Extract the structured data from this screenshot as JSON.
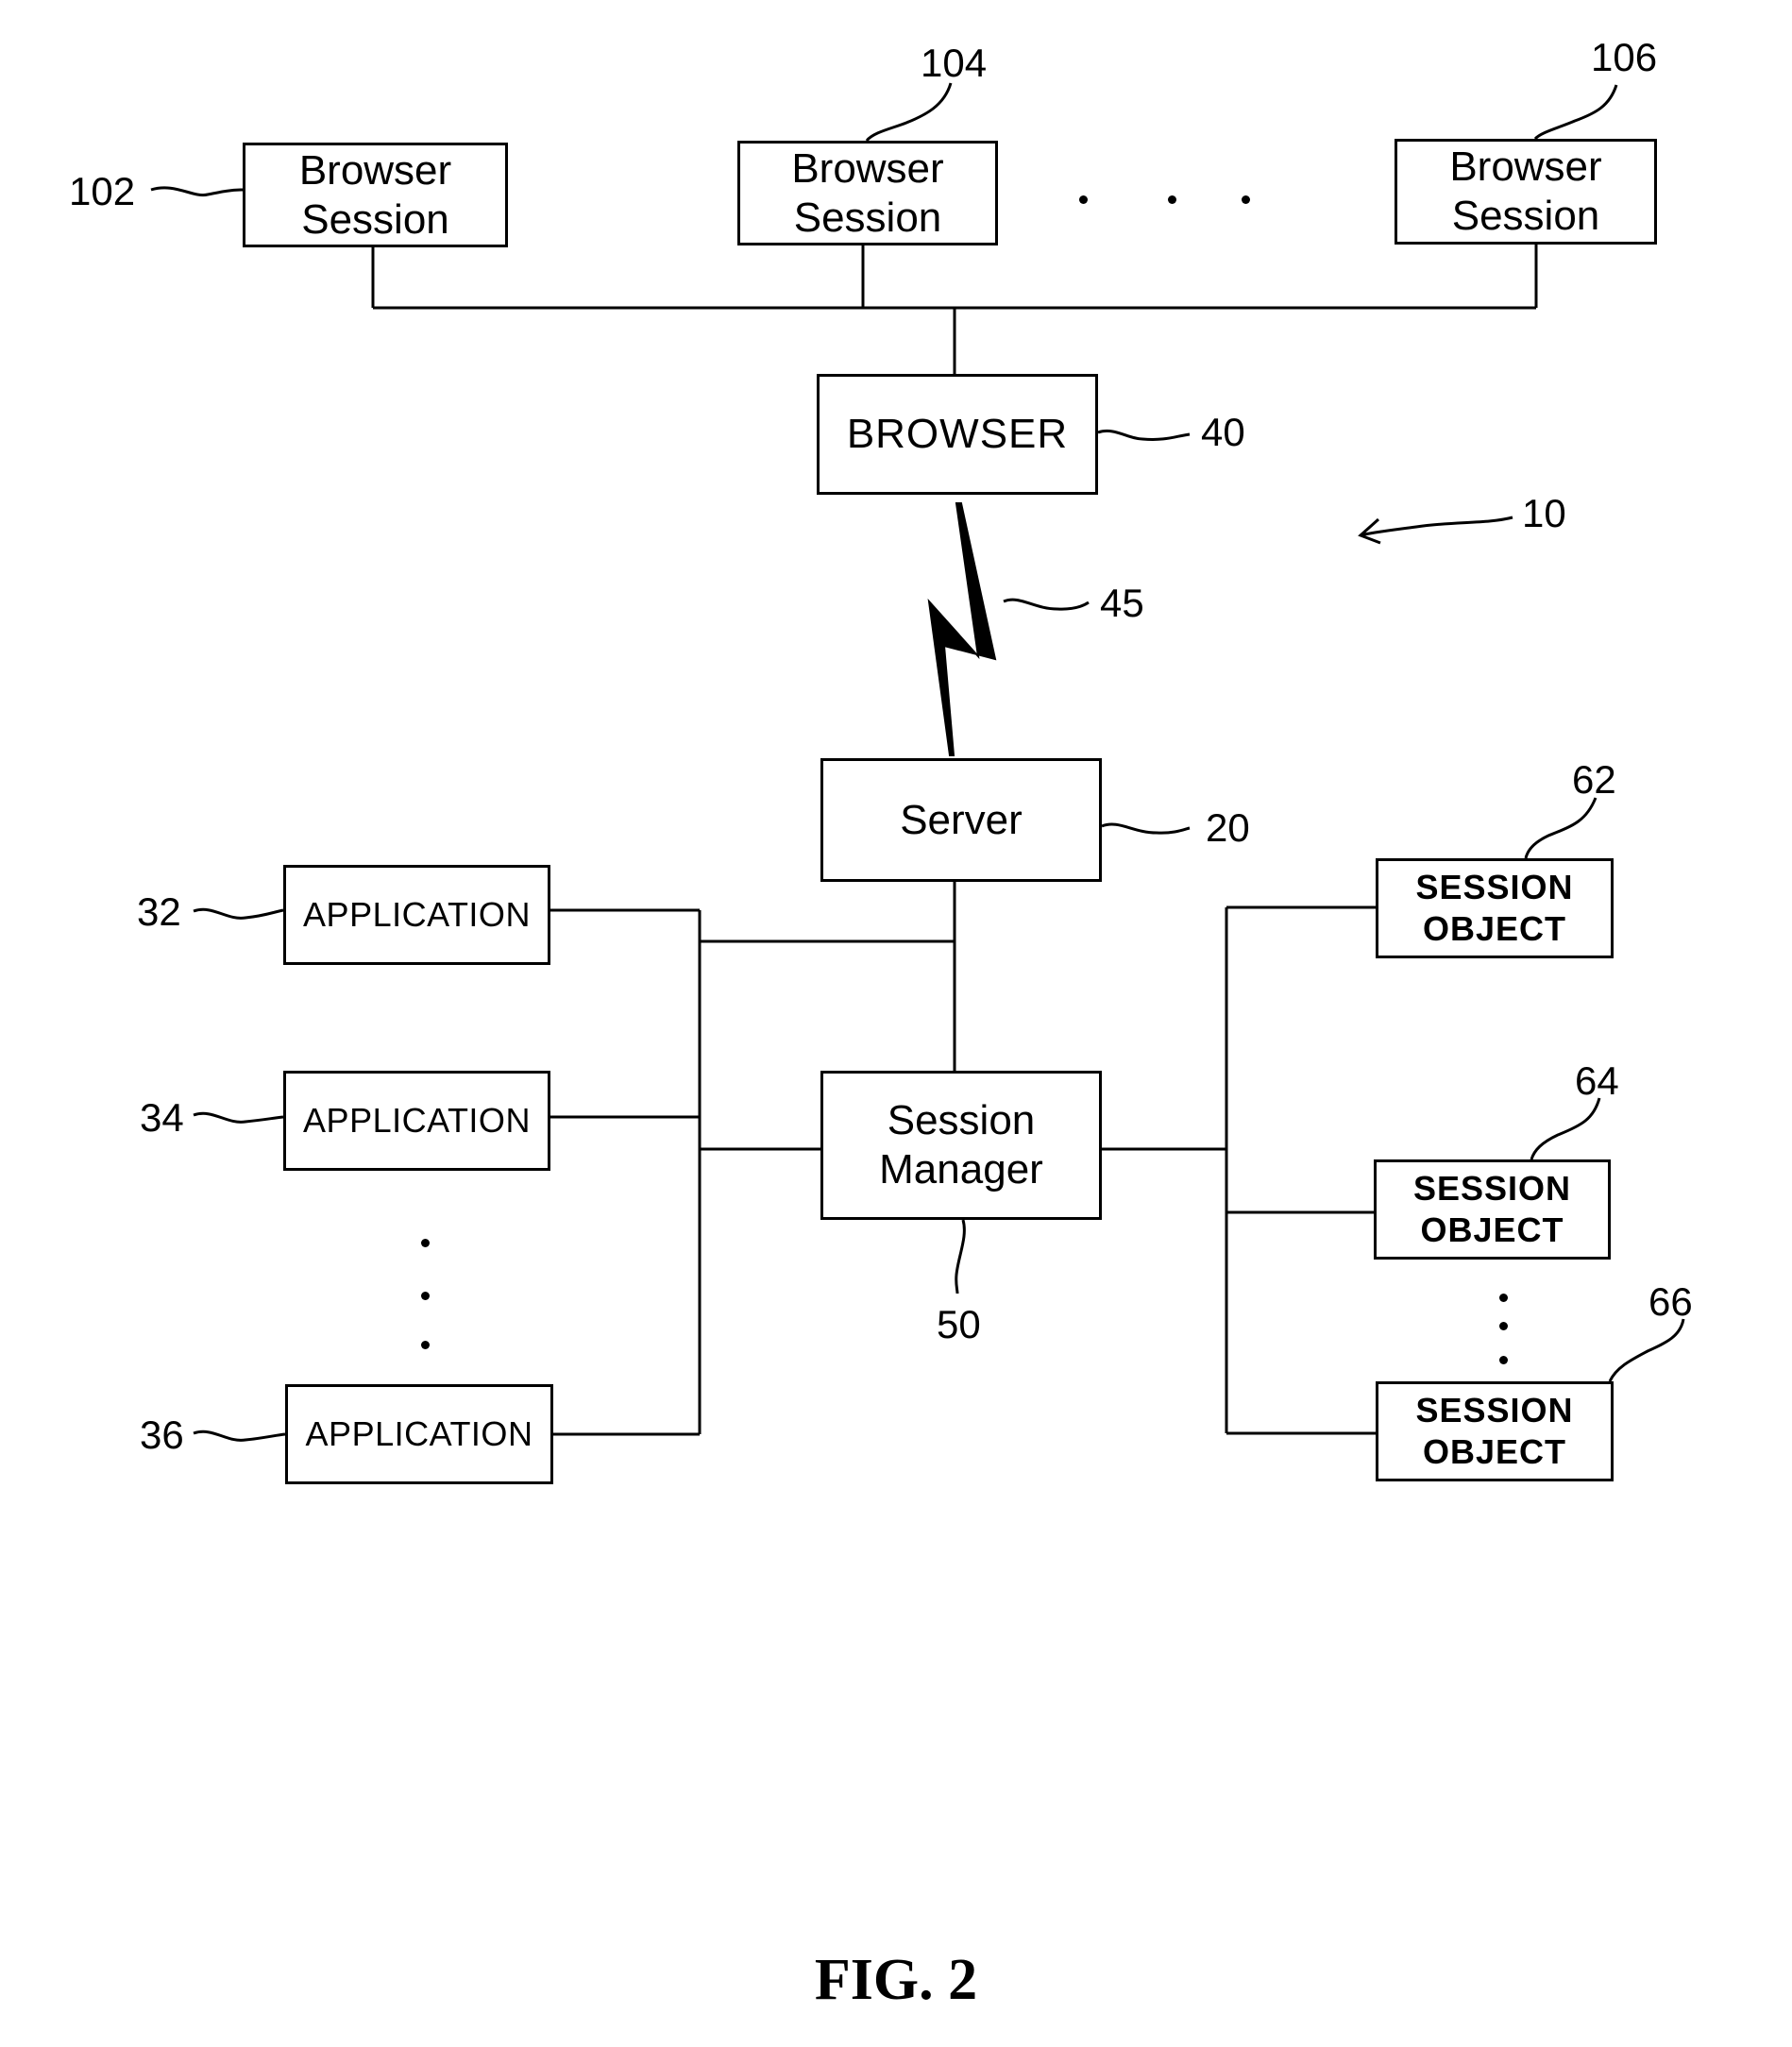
{
  "figure": {
    "caption": "FIG. 2",
    "system_ref": "10"
  },
  "browser_sessions": [
    {
      "ref": "102",
      "line1": "Browser",
      "line2": "Session"
    },
    {
      "ref": "104",
      "line1": "Browser",
      "line2": "Session"
    },
    {
      "ref": "106",
      "line1": "Browser",
      "line2": "Session"
    }
  ],
  "browser": {
    "ref": "40",
    "label": "BROWSER"
  },
  "link": {
    "ref": "45",
    "icon": "lightning-bolt-icon"
  },
  "server": {
    "ref": "20",
    "label": "Server"
  },
  "session_manager": {
    "ref": "50",
    "line1": "Session",
    "line2": "Manager"
  },
  "applications": [
    {
      "ref": "32",
      "label": "APPLICATION"
    },
    {
      "ref": "34",
      "label": "APPLICATION"
    },
    {
      "ref": "36",
      "label": "APPLICATION"
    }
  ],
  "session_objects": [
    {
      "ref": "62",
      "line1": "SESSION",
      "line2": "OBJECT"
    },
    {
      "ref": "64",
      "line1": "SESSION",
      "line2": "OBJECT"
    },
    {
      "ref": "66",
      "line1": "SESSION",
      "line2": "OBJECT"
    }
  ]
}
